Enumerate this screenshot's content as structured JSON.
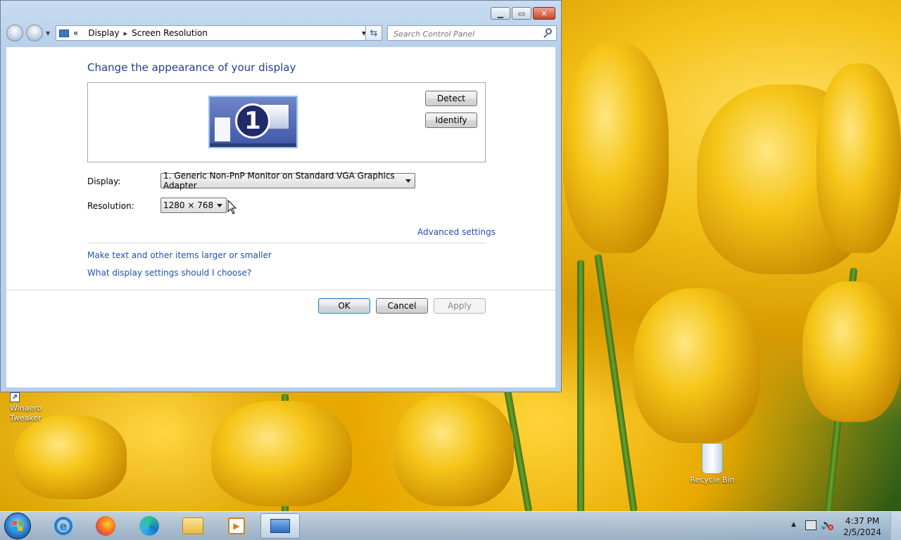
{
  "window": {
    "nav": {
      "breadcrumb_prefix": "«",
      "crumb1": "Display",
      "crumb_sep": "▸",
      "crumb2": "Screen Resolution",
      "search_placeholder": "Search Control Panel"
    },
    "heading": "Change the appearance of your display",
    "monitor_number": "1",
    "buttons": {
      "detect": "Detect",
      "identify": "Identify",
      "ok": "OK",
      "cancel": "Cancel",
      "apply": "Apply"
    },
    "display": {
      "label": "Display:",
      "value": "1. Generic Non-PnP Monitor on Standard VGA Graphics Adapter"
    },
    "resolution": {
      "label": "Resolution:",
      "value": "1280 × 768"
    },
    "links": {
      "advanced": "Advanced settings",
      "text_size": "Make text and other items larger or smaller",
      "which_settings": "What display settings should I choose?"
    }
  },
  "desktop": {
    "icons": [
      {
        "label": "Winaero Tweaker"
      },
      {
        "label": "Recycle Bin"
      }
    ]
  },
  "taskbar": {
    "clock_time": "4:37 PM",
    "clock_date": "2/5/2024"
  },
  "colors": {
    "link": "#1e4fb0",
    "heading": "#1e3f8f"
  }
}
